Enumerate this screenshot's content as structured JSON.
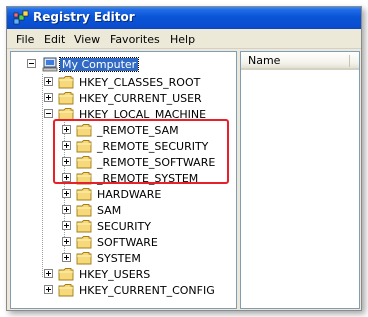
{
  "window": {
    "title": "Registry Editor",
    "icon": "registry-editor-icon"
  },
  "menu": {
    "items": [
      "File",
      "Edit",
      "View",
      "Favorites",
      "Help"
    ]
  },
  "tree": {
    "root": {
      "label": "My Computer",
      "icon": "computer-icon",
      "expanded": true,
      "selected": true
    },
    "nodes": [
      {
        "label": "HKEY_CLASSES_ROOT",
        "expanded": false,
        "level": 1
      },
      {
        "label": "HKEY_CURRENT_USER",
        "expanded": false,
        "level": 1
      },
      {
        "label": "HKEY_LOCAL_MACHINE",
        "expanded": true,
        "level": 1
      },
      {
        "label": "_REMOTE_SAM",
        "expanded": false,
        "level": 2,
        "highlighted": true
      },
      {
        "label": "_REMOTE_SECURITY",
        "expanded": false,
        "level": 2,
        "highlighted": true
      },
      {
        "label": "_REMOTE_SOFTWARE",
        "expanded": false,
        "level": 2,
        "highlighted": true
      },
      {
        "label": "_REMOTE_SYSTEM",
        "expanded": false,
        "level": 2,
        "highlighted": true
      },
      {
        "label": "HARDWARE",
        "expanded": false,
        "level": 2
      },
      {
        "label": "SAM",
        "expanded": false,
        "level": 2
      },
      {
        "label": "SECURITY",
        "expanded": false,
        "level": 2
      },
      {
        "label": "SOFTWARE",
        "expanded": false,
        "level": 2
      },
      {
        "label": "SYSTEM",
        "expanded": false,
        "level": 2
      },
      {
        "label": "HKEY_USERS",
        "expanded": false,
        "level": 1
      },
      {
        "label": "HKEY_CURRENT_CONFIG",
        "expanded": false,
        "level": 1
      }
    ]
  },
  "list": {
    "columns": [
      "Name"
    ]
  },
  "colors": {
    "titlebar": "#0a54d6",
    "selection": "#316ac5",
    "highlight_box": "#e8202a",
    "folder": "#f5d97a"
  }
}
